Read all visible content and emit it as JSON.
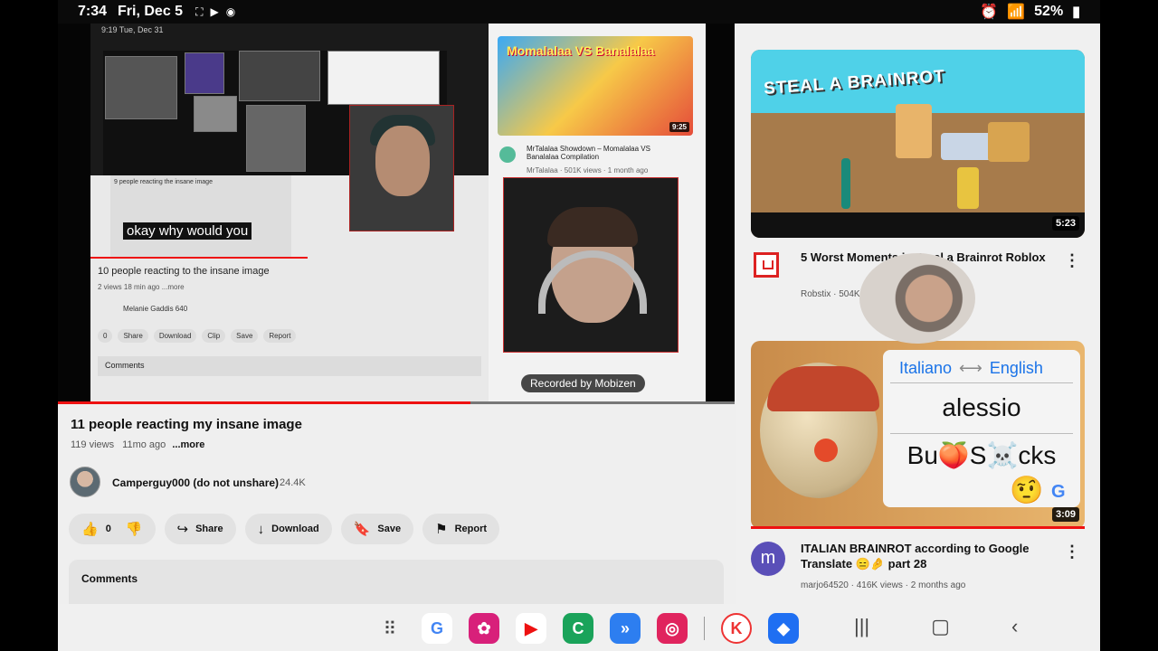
{
  "status": {
    "time": "7:34",
    "date": "Fri, Dec 5",
    "battery": "52%"
  },
  "recording": {
    "inner_time": "9:19  Tue, Dec 31",
    "caption": "okay why would you",
    "inner_video_title": "10 people reacting to the insane image",
    "inner_video_meta": "2 views  18 min ago  ...more",
    "inner_channel": "Melanie Gaddis  640",
    "inner_actions": [
      "0",
      "Share",
      "Download",
      "Clip",
      "Save",
      "Report"
    ],
    "inner_comments": "Comments",
    "sub_card_title": "9 people reacting the insane image",
    "side_video_title": "MrTalalaa Showdown – Momalalaa VS Banalalaa Compilation",
    "side_video_meta": "MrTalalaa · 501K views · 1 month ago",
    "side_thumb_text": "Momalalaa VS Banalalaa",
    "side_thumb_duration": "9:25",
    "watermark": "Recorded by Mobizen"
  },
  "video": {
    "title": "11 people reacting my insane image",
    "views": "119 views",
    "age": "11mo ago",
    "more": "...more",
    "progress": 0.61
  },
  "channel": {
    "name": "Camperguy000 (do not unshare)",
    "subs": "24.4K"
  },
  "actions": {
    "likes": "0",
    "share": "Share",
    "download": "Download",
    "save": "Save",
    "report": "Report"
  },
  "comments": {
    "label": "Comments"
  },
  "recommendations": [
    {
      "thumb_text": "STEAL A BRAINROT",
      "duration": "5:23",
      "title": "5 Worst Moments in Steal a Brainrot Roblox",
      "meta": "Robstix · 504K views"
    },
    {
      "lang_from": "Italiano",
      "lang_to": "English",
      "word1": "alessio",
      "word2": "Bu🍑S☠️cks",
      "duration": "3:09",
      "title": "ITALIAN BRAINROT according to Google Translate 😑🤌 part 28",
      "meta": "marjo64520 · 416K views · 2 months ago",
      "avatar_letter": "m"
    }
  ],
  "dock": {
    "apps": [
      "Google",
      "Gallery",
      "YouTube",
      "Phone",
      "Media",
      "Screen Recorder",
      "KineMaster",
      "Roblox"
    ]
  },
  "colors": {
    "accent_red": "#e11d1d",
    "link_blue": "#1a73e8"
  }
}
